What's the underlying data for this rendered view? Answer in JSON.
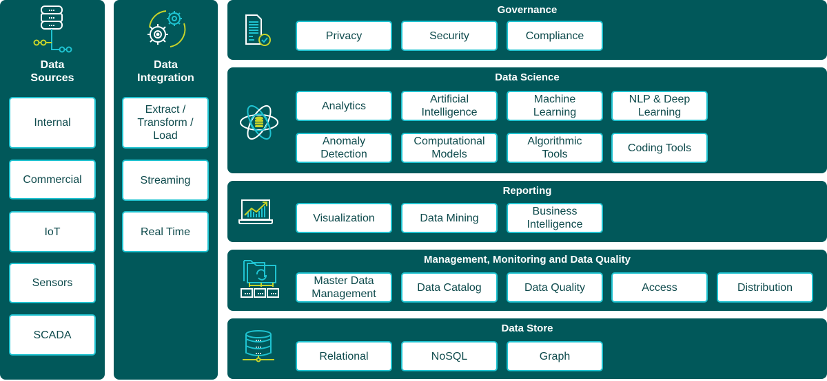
{
  "colors": {
    "panel_bg": "#01585a",
    "box_border": "#1fc3d1",
    "box_text": "#0e4a4c",
    "accent_lime": "#c8d42a",
    "accent_cyan": "#1fc3d1"
  },
  "columns": [
    {
      "title_line1": "Data",
      "title_line2": "Sources",
      "icon": "database-network-icon",
      "items": [
        "Internal",
        "Commercial",
        "IoT",
        "Sensors",
        "SCADA"
      ]
    },
    {
      "title_line1": "Data",
      "title_line2": "Integration",
      "icon": "gears-icon",
      "items": [
        "Extract / Transform / Load",
        "Streaming",
        "Real Time"
      ]
    }
  ],
  "rows": [
    {
      "title": "Governance",
      "icon": "document-check-icon",
      "items": [
        "Privacy",
        "Security",
        "Compliance"
      ]
    },
    {
      "title": "Data Science",
      "icon": "atom-database-icon",
      "items": [
        "Analytics",
        "Artificial Intelligence",
        "Machine Learning",
        "NLP & Deep Learning",
        "Anomaly Detection",
        "Computational Models",
        "Algorithmic Tools",
        "Coding Tools"
      ]
    },
    {
      "title": "Reporting",
      "icon": "laptop-chart-icon",
      "items": [
        "Visualization",
        "Data Mining",
        "Business Intelligence"
      ]
    },
    {
      "title": "Management, Monitoring and Data Quality",
      "icon": "folder-sync-icon",
      "items": [
        "Master Data Management",
        "Data Catalog",
        "Data Quality",
        "Access",
        "Distribution"
      ]
    },
    {
      "title": "Data Store",
      "icon": "database-stack-icon",
      "items": [
        "Relational",
        "NoSQL",
        "Graph"
      ]
    }
  ]
}
